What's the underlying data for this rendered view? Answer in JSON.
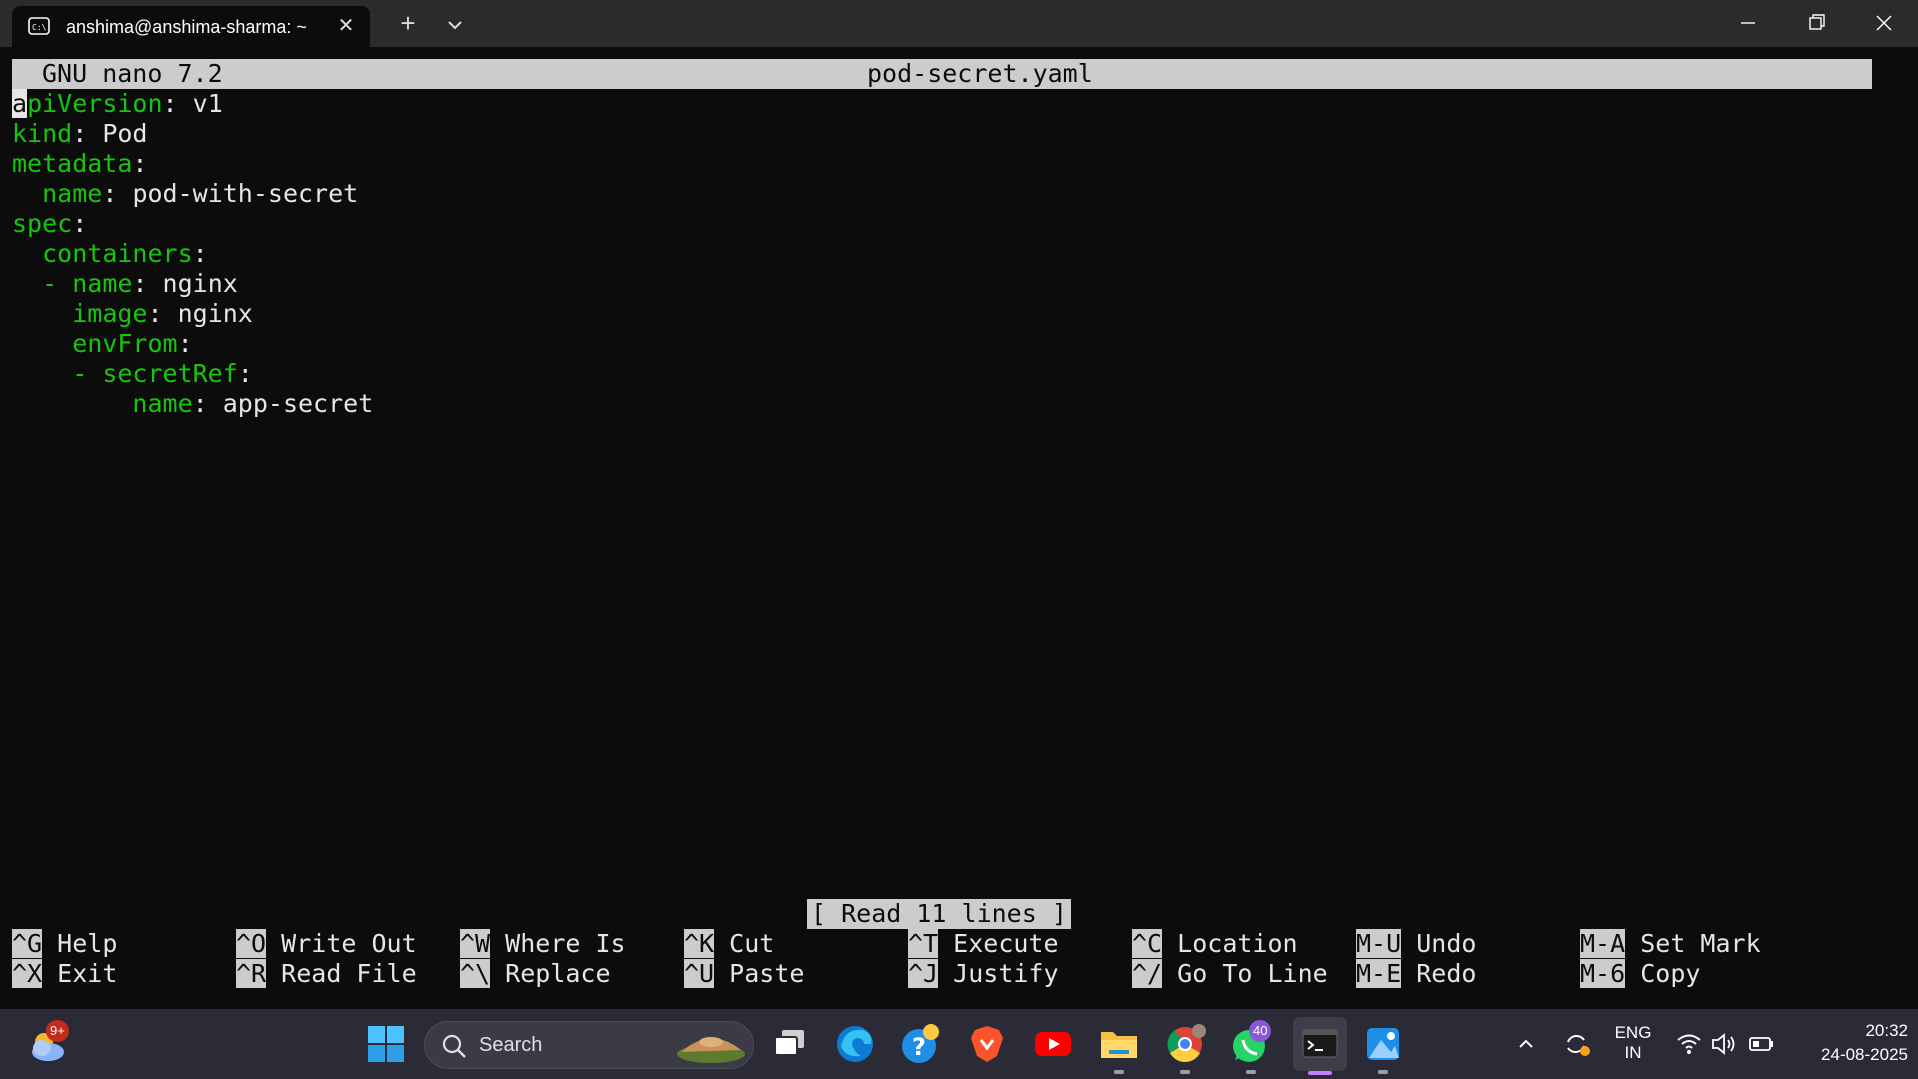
{
  "window": {
    "tab_title": "anshima@anshima-sharma: ~",
    "tab_icon": "terminal-tab-icon",
    "new_tab": "+",
    "close_tab": "✕"
  },
  "nano": {
    "header_left": "GNU nano 7.2",
    "filename": "pod-secret.yaml",
    "lines": [
      {
        "indent": "",
        "dash": "",
        "key": "apiVersion",
        "value": " v1"
      },
      {
        "indent": "",
        "dash": "",
        "key": "kind",
        "value": " Pod"
      },
      {
        "indent": "",
        "dash": "",
        "key": "metadata",
        "value": ""
      },
      {
        "indent": "  ",
        "dash": "",
        "key": "name",
        "value": " pod-with-secret"
      },
      {
        "indent": "",
        "dash": "",
        "key": "spec",
        "value": ""
      },
      {
        "indent": "  ",
        "dash": "",
        "key": "containers",
        "value": ""
      },
      {
        "indent": "  ",
        "dash": "- ",
        "key": "name",
        "value": " nginx"
      },
      {
        "indent": "    ",
        "dash": "",
        "key": "image",
        "value": " nginx"
      },
      {
        "indent": "    ",
        "dash": "",
        "key": "envFrom",
        "value": ""
      },
      {
        "indent": "    ",
        "dash": "- ",
        "key": "secretRef",
        "value": ""
      },
      {
        "indent": "        ",
        "dash": "",
        "key": "name",
        "value": " app-secret"
      }
    ],
    "status": "[ Read 11 lines ]",
    "shortcuts": [
      {
        "key": "^G",
        "label": "Help"
      },
      {
        "key": "^X",
        "label": "Exit"
      },
      {
        "key": "^O",
        "label": "Write Out"
      },
      {
        "key": "^R",
        "label": "Read File"
      },
      {
        "key": "^W",
        "label": "Where Is"
      },
      {
        "key": "^\\",
        "label": "Replace"
      },
      {
        "key": "^K",
        "label": "Cut"
      },
      {
        "key": "^U",
        "label": "Paste"
      },
      {
        "key": "^T",
        "label": "Execute"
      },
      {
        "key": "^J",
        "label": "Justify"
      },
      {
        "key": "^C",
        "label": "Location"
      },
      {
        "key": "^/",
        "label": "Go To Line"
      },
      {
        "key": "M-U",
        "label": "Undo"
      },
      {
        "key": "M-E",
        "label": "Redo"
      },
      {
        "key": "M-A",
        "label": "Set Mark"
      },
      {
        "key": "M-6",
        "label": "Copy"
      }
    ]
  },
  "taskbar": {
    "search_placeholder": "Search",
    "weather_badge": "9+",
    "whatsapp_badge": "40",
    "lang_top": "ENG",
    "lang_bottom": "IN",
    "time": "20:32",
    "date": "24-08-2025"
  },
  "colors": {
    "terminal_bg": "#0c0c0c",
    "yaml_key": "#16c60c",
    "text": "#e6e6e6",
    "nano_bar": "#cccccc",
    "taskbar_bg": "#2a2b36"
  }
}
